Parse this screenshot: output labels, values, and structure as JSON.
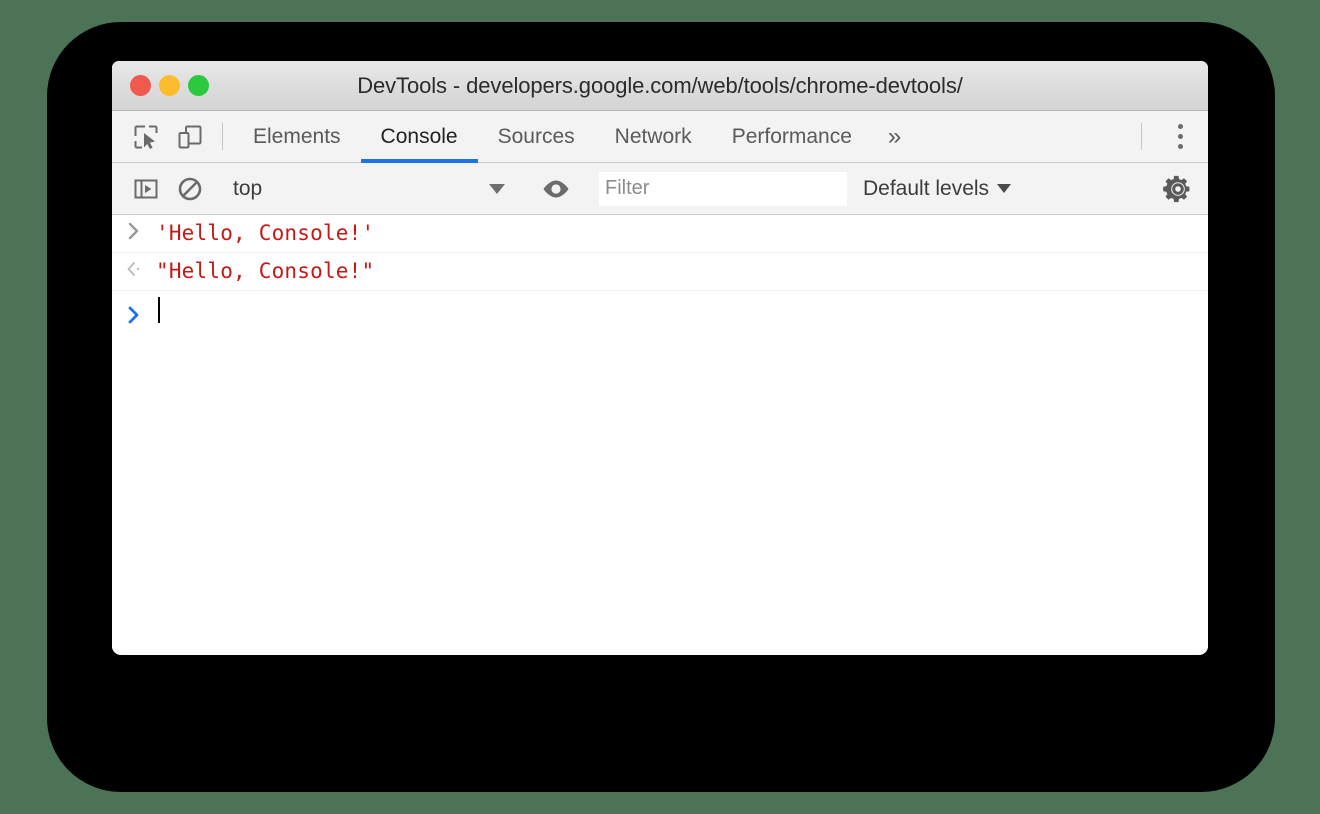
{
  "window": {
    "title": "DevTools - developers.google.com/web/tools/chrome-devtools/",
    "traffic_lights": [
      {
        "name": "close",
        "color": "#f0594d"
      },
      {
        "name": "minimize",
        "color": "#fbbd2d"
      },
      {
        "name": "maximize",
        "color": "#2bc940"
      }
    ]
  },
  "tabstrip": {
    "inspect_icon": "inspect-element-icon",
    "device_icon": "device-toolbar-icon",
    "tabs": [
      {
        "label": "Elements",
        "active": false
      },
      {
        "label": "Console",
        "active": true
      },
      {
        "label": "Sources",
        "active": false
      },
      {
        "label": "Network",
        "active": false
      },
      {
        "label": "Performance",
        "active": false
      }
    ],
    "overflow_label": "»",
    "menu_icon": "kebab-menu-icon",
    "active_underline_color": "#1a73e8"
  },
  "console_toolbar": {
    "sidebar_toggle_icon": "console-sidebar-toggle-icon",
    "clear_icon": "clear-console-icon",
    "context": {
      "value": "top",
      "caret": "▼"
    },
    "eye_icon": "live-expression-eye-icon",
    "filter": {
      "placeholder": "Filter",
      "value": ""
    },
    "levels": {
      "label": "Default levels",
      "caret": "▼"
    },
    "settings_icon": "settings-gear-icon"
  },
  "console": {
    "string_color": "#c41a16",
    "prompt_color": "#1a73e8",
    "rows": [
      {
        "type": "input",
        "gutter_glyph": "›",
        "gutter_name": "input-arrow-icon",
        "text": "'Hello, Console!'"
      },
      {
        "type": "output",
        "gutter_glyph": "‹·",
        "gutter_name": "output-arrow-icon",
        "text": "\"Hello, Console!\""
      }
    ],
    "prompt": {
      "glyph": "›",
      "value": ""
    }
  },
  "colors": {
    "page_background": "#4c7355",
    "backdrop": "#000000",
    "toolbar_background": "#f3f3f3",
    "panel_background": "#ffffff"
  }
}
